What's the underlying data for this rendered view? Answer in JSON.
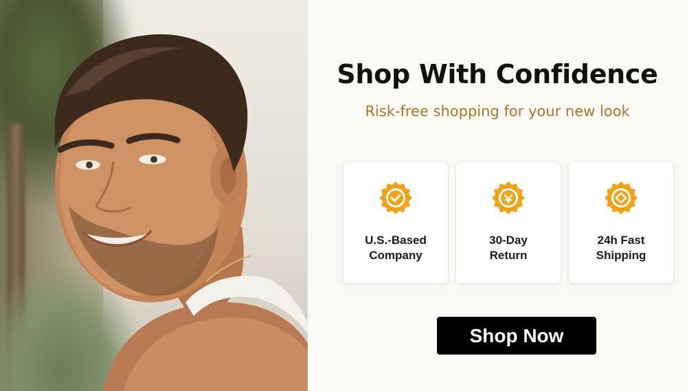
{
  "banner": {
    "headline": "Shop With Confidence",
    "subheadline": "Risk-free shopping for your new look",
    "features": [
      {
        "label": "U.S.-Based\nCompany",
        "icon": "check-badge-icon"
      },
      {
        "label": "30-Day\nReturn",
        "icon": "return-badge-icon"
      },
      {
        "label": "24h Fast\nShipping",
        "icon": "diamond-badge-icon"
      }
    ],
    "cta_label": "Shop Now"
  },
  "colors": {
    "background": "#fbf9f4",
    "headline": "#111111",
    "subheadline": "#a8752c",
    "badge": "#f0a315",
    "cta_background": "#000000",
    "cta_text": "#ffffff"
  }
}
